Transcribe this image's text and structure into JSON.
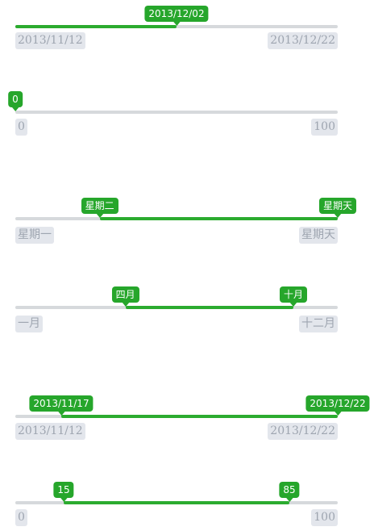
{
  "colors": {
    "accent": "#26a62b",
    "track": "#d6d9dc",
    "label_bg": "#e3e6ec",
    "label_text": "#9ea5b0"
  },
  "sliders": [
    {
      "min_label": "2013/11/12",
      "max_label": "2013/12/22",
      "handles": [
        {
          "label": "2013/12/02",
          "fraction": 0.5
        }
      ]
    },
    {
      "min_label": "0",
      "max_label": "100",
      "handles": [
        {
          "label": "0",
          "fraction": 0.0
        }
      ]
    },
    {
      "min_label": "星期一",
      "max_label": "星期天",
      "handles": [
        {
          "label": "星期二",
          "fraction": 0.2617
        },
        {
          "label": "星期天",
          "fraction": 1.0
        }
      ]
    },
    {
      "min_label": "一月",
      "max_label": "十二月",
      "handles": [
        {
          "label": "四月",
          "fraction": 0.3415
        },
        {
          "label": "十月",
          "fraction": 0.8625
        }
      ]
    },
    {
      "min_label": "2013/11/12",
      "max_label": "2013/12/22",
      "handles": [
        {
          "label": "2013/11/17",
          "fraction": 0.1425
        },
        {
          "label": "2013/12/22",
          "fraction": 1.0
        }
      ]
    },
    {
      "min_label": "0",
      "max_label": "100",
      "handles": [
        {
          "label": "15",
          "fraction": 0.15
        },
        {
          "label": "85",
          "fraction": 0.85
        }
      ]
    }
  ]
}
